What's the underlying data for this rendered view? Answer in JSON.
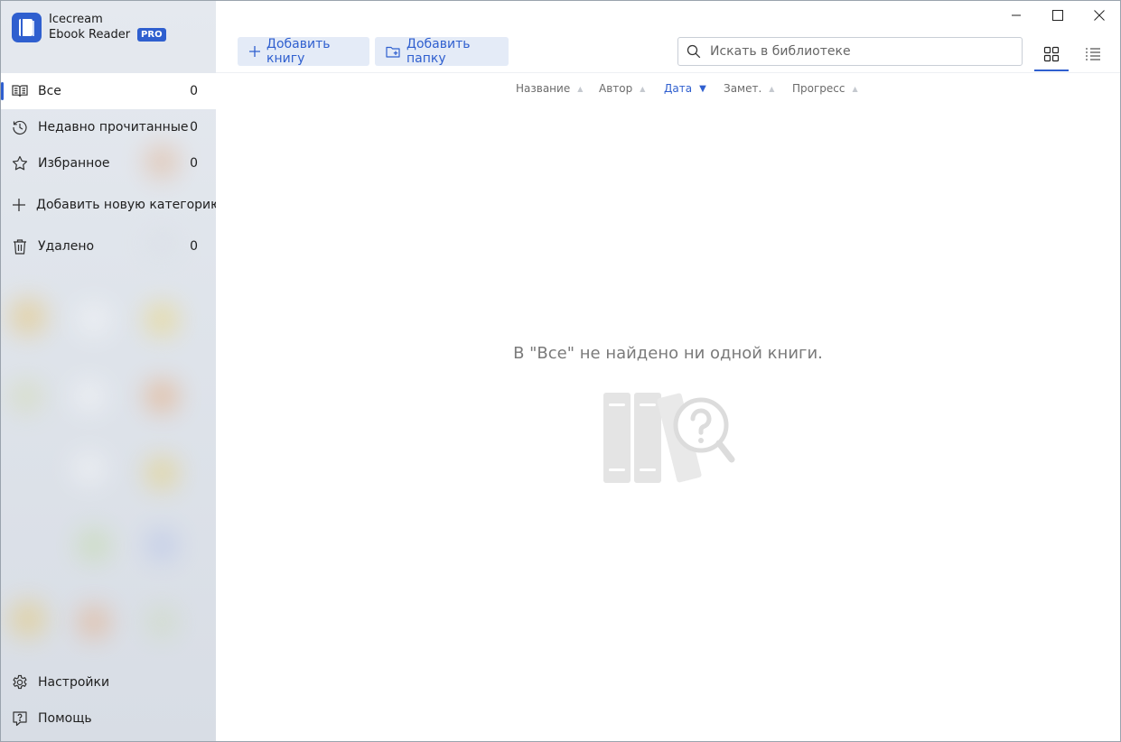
{
  "app": {
    "name_line1": "Icecream",
    "name_line2": "Ebook Reader",
    "badge": "PRO"
  },
  "sidebar": {
    "items": [
      {
        "label": "Все",
        "count": "0",
        "icon": "book-open-icon",
        "active": true
      },
      {
        "label": "Недавно прочитанные",
        "count": "0",
        "icon": "history-icon"
      },
      {
        "label": "Избранное",
        "count": "0",
        "icon": "star-icon"
      },
      {
        "label": "Добавить новую категорию",
        "icon": "plus-icon"
      },
      {
        "label": "Удалено",
        "count": "0",
        "icon": "trash-icon"
      }
    ],
    "bottom": [
      {
        "label": "Настройки",
        "icon": "gear-icon"
      },
      {
        "label": "Помощь",
        "icon": "help-icon"
      }
    ]
  },
  "toolbar": {
    "add_book": "Добавить книгу",
    "add_folder": "Добавить папку",
    "search_placeholder": "Искать в библиотеке"
  },
  "sort": {
    "columns": [
      {
        "label": "Название"
      },
      {
        "label": "Автор"
      },
      {
        "label": "Дата",
        "active": true
      },
      {
        "label": "Замет."
      },
      {
        "label": "Прогресс"
      }
    ]
  },
  "empty_state": {
    "message": "В \"Все\" не найдено ни одной книги."
  },
  "colors": {
    "accent": "#2f5fcf",
    "sidebar_bg": "#e2e6ec"
  }
}
